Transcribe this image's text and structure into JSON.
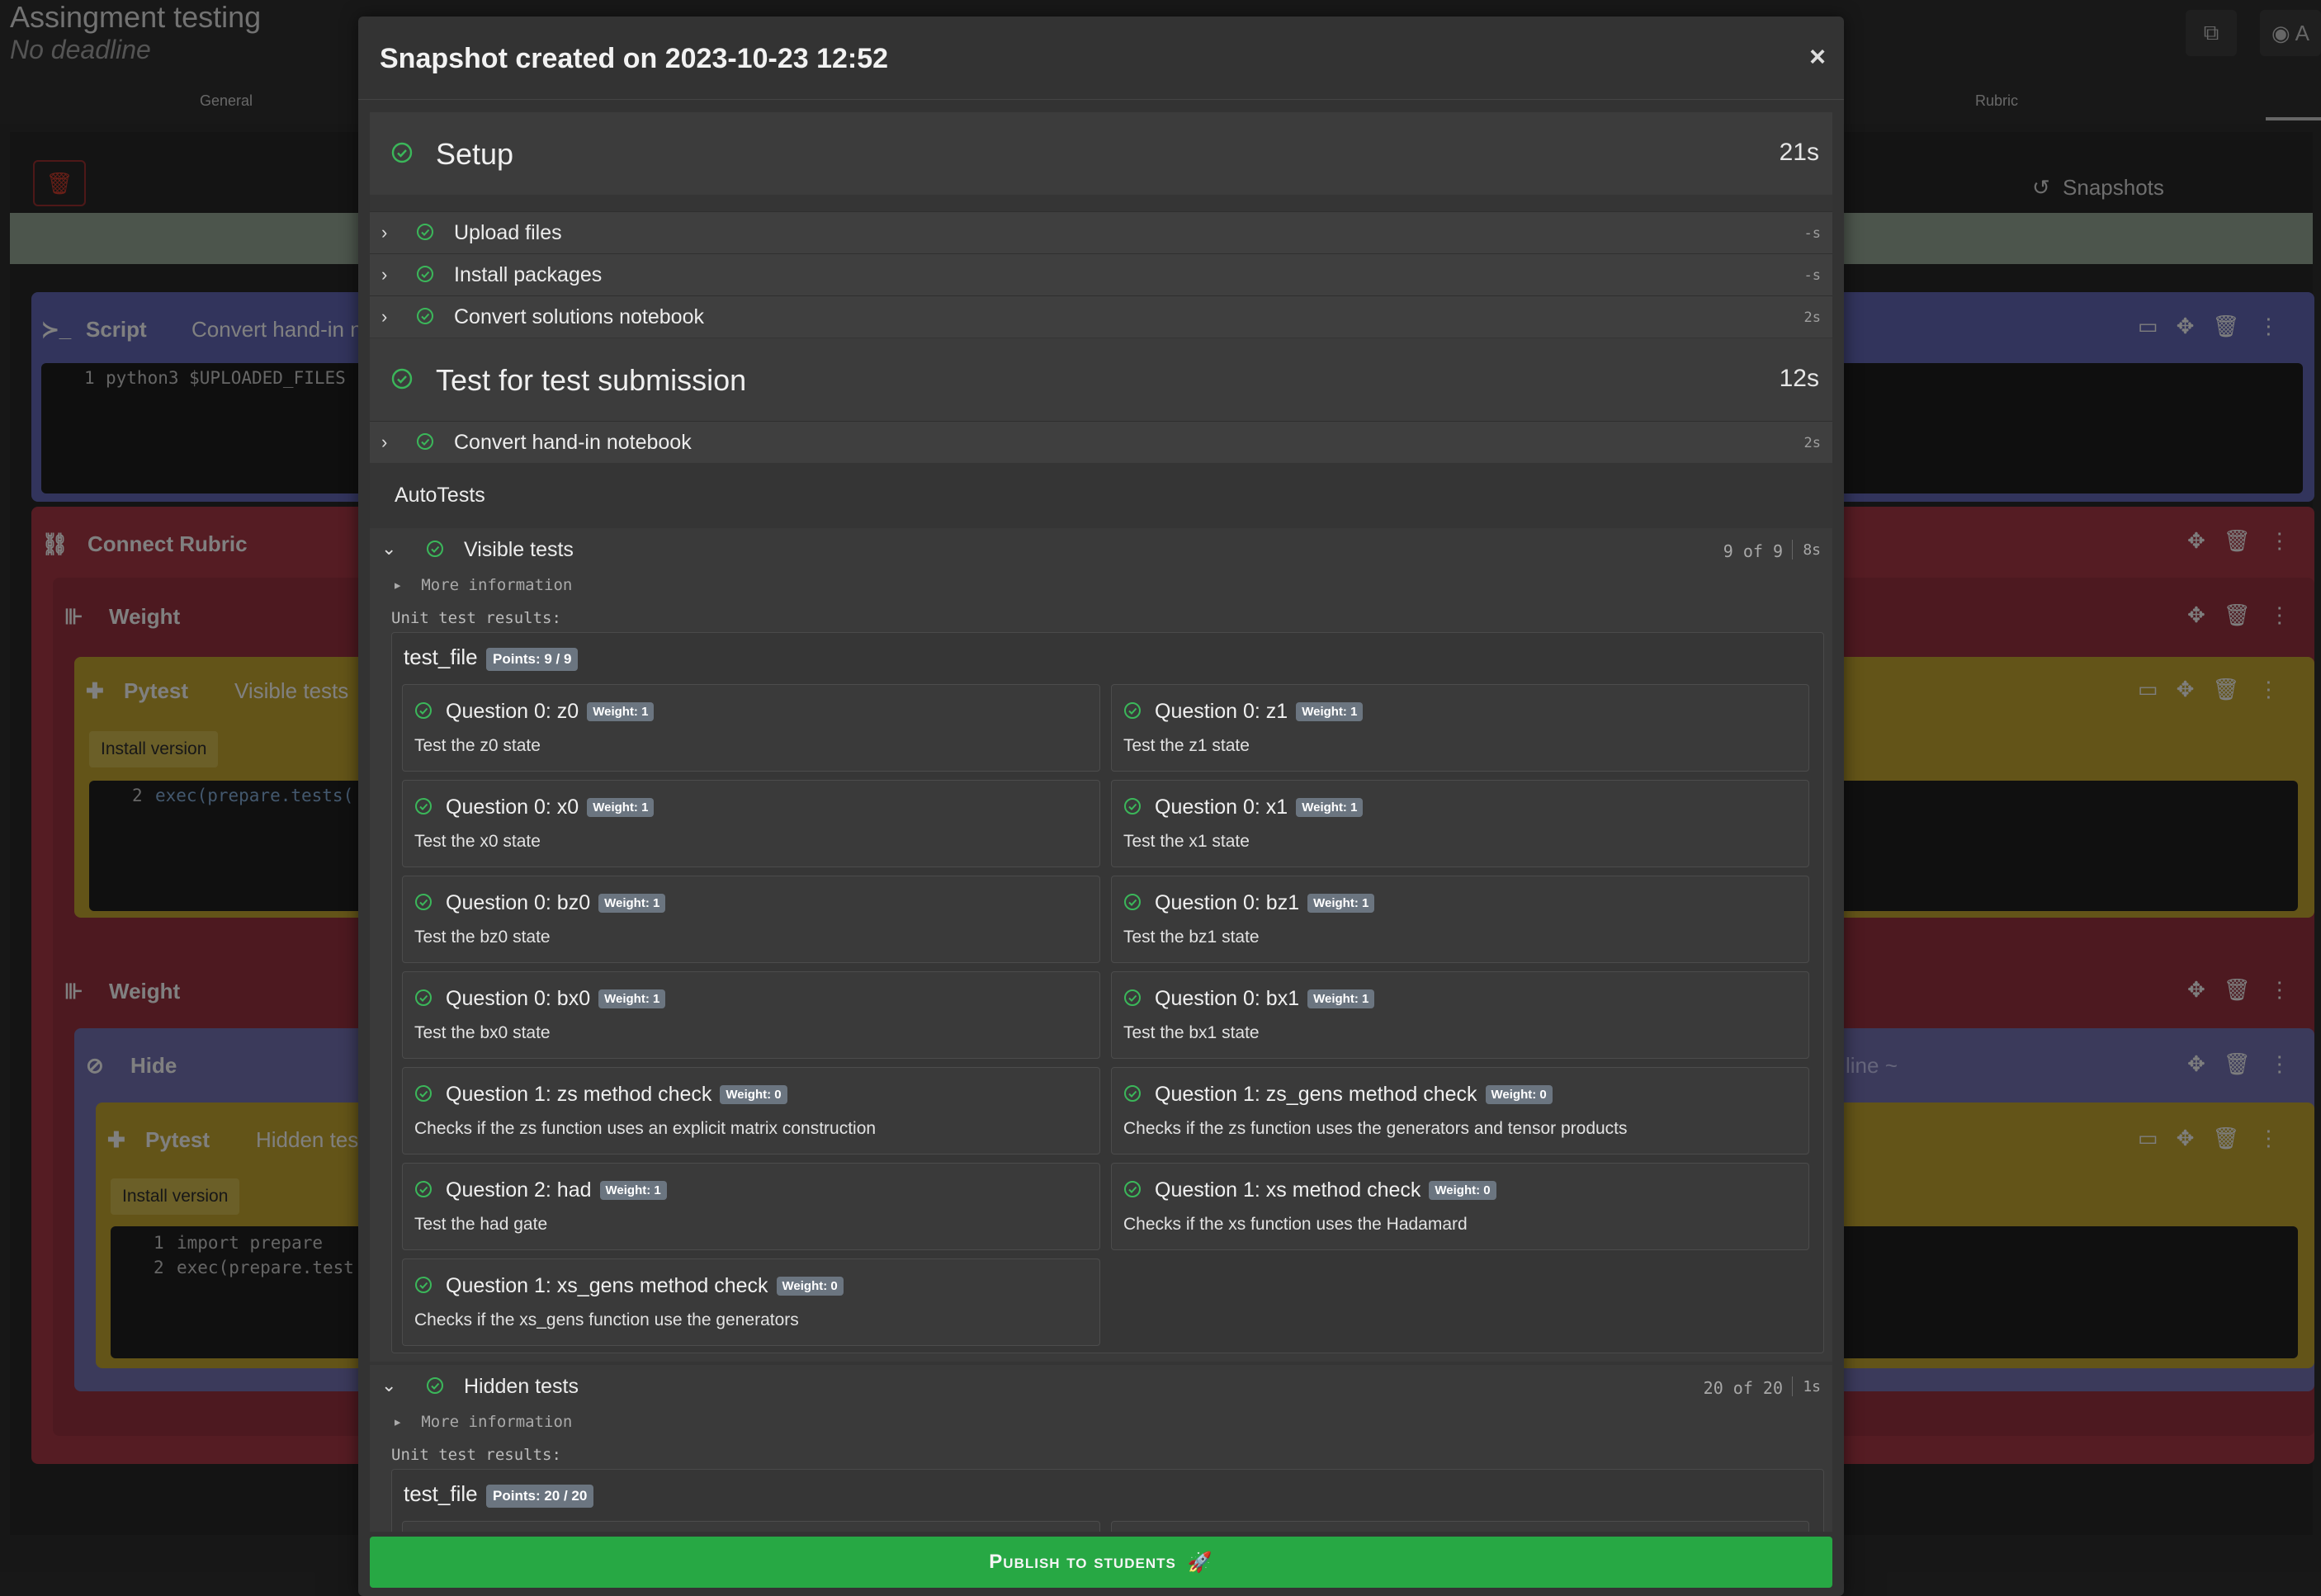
{
  "background": {
    "title": "Assingment testing",
    "subtitle": "No deadline",
    "tabs": [
      "General",
      "Rubric"
    ],
    "snapshots_label": "Snapshots",
    "top_button_label": "A",
    "blocks": {
      "script_label": "Script",
      "script_desc": "Convert hand-in no",
      "script_code_lineno": "1",
      "script_code": "python3 $UPLOADED_FILES",
      "connect_rubric_label": "Connect Rubric",
      "weight_label": "Weight",
      "pytest_label": "Pytest",
      "pytest_desc_visible": "Visible tests",
      "install_version": "Install version",
      "pytest_code_lineno": "2",
      "pytest_code": "exec(prepare.tests(",
      "hide_label": "Hide",
      "hide_hint": "line ~",
      "pytest_desc_hidden": "Hidden tes",
      "hidden_code_line1_no": "1",
      "hidden_code_line1": "import prepare",
      "hidden_code_line2_no": "2",
      "hidden_code_line2": "exec(prepare.test"
    }
  },
  "modal": {
    "title": "Snapshot created on 2023-10-23 12:52",
    "close": "×",
    "setup": {
      "name": "Setup",
      "time": "21s",
      "steps": [
        {
          "name": "Upload files",
          "time": "-s"
        },
        {
          "name": "Install packages",
          "time": "-s"
        },
        {
          "name": "Convert solutions notebook",
          "time": "2s"
        }
      ]
    },
    "test_section": {
      "name": "Test for test submission",
      "time": "12s",
      "steps": [
        {
          "name": "Convert hand-in notebook",
          "time": "2s"
        }
      ]
    },
    "autotests_label": "AutoTests",
    "visible": {
      "name": "Visible tests",
      "count": "9 of 9",
      "time": "8s",
      "more_info": "More information",
      "unit_label": "Unit test results:",
      "file_name": "test_file",
      "points": "Points: 9 / 9",
      "tests": [
        {
          "name": "Question 0: z0",
          "weight": "Weight: 1",
          "desc": "Test the z0 state"
        },
        {
          "name": "Question 0: z1",
          "weight": "Weight: 1",
          "desc": "Test the z1 state"
        },
        {
          "name": "Question 0: x0",
          "weight": "Weight: 1",
          "desc": "Test the x0 state"
        },
        {
          "name": "Question 0: x1",
          "weight": "Weight: 1",
          "desc": "Test the x1 state"
        },
        {
          "name": "Question 0: bz0",
          "weight": "Weight: 1",
          "desc": "Test the bz0 state"
        },
        {
          "name": "Question 0: bz1",
          "weight": "Weight: 1",
          "desc": "Test the bz1 state"
        },
        {
          "name": "Question 0: bx0",
          "weight": "Weight: 1",
          "desc": "Test the bx0 state"
        },
        {
          "name": "Question 0: bx1",
          "weight": "Weight: 1",
          "desc": "Test the bx1 state"
        },
        {
          "name": "Question 1: zs method check",
          "weight": "Weight: 0",
          "desc": "Checks if the zs function uses an explicit matrix construction"
        },
        {
          "name": "Question 1: zs_gens method check",
          "weight": "Weight: 0",
          "desc": "Checks if the zs function uses the generators and tensor products"
        },
        {
          "name": "Question 2: had",
          "weight": "Weight: 1",
          "desc": "Test the had gate"
        },
        {
          "name": "Question 1: xs method check",
          "weight": "Weight: 0",
          "desc": "Checks if the xs function uses the Hadamard"
        },
        {
          "name": "Question 1: xs_gens method check",
          "weight": "Weight: 0",
          "desc": "Checks if the xs_gens function use the generators"
        }
      ]
    },
    "hidden": {
      "name": "Hidden tests",
      "count": "20 of 20",
      "time": "1s",
      "more_info": "More information",
      "unit_label": "Unit test results:",
      "file_name": "test_file",
      "points": "Points: 20 / 20"
    },
    "publish_label": "Publish to students"
  },
  "colors": {
    "success": "#27a844",
    "check": "#3bb75a",
    "badge": "#6b7580"
  }
}
